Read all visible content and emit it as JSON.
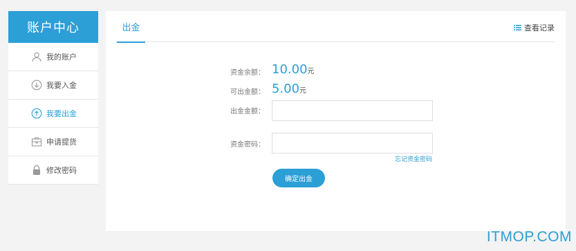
{
  "sidebar": {
    "title": "账户中心",
    "items": [
      {
        "label": "我的账户",
        "icon": "user-icon"
      },
      {
        "label": "我要入金",
        "icon": "arrow-down-circle-icon"
      },
      {
        "label": "我要出金",
        "icon": "arrow-up-circle-icon",
        "active": true
      },
      {
        "label": "申请提货",
        "icon": "briefcase-icon"
      },
      {
        "label": "修改密码",
        "icon": "lock-icon"
      }
    ]
  },
  "main": {
    "tab": "出金",
    "records_label": "查看记录",
    "balance": {
      "label": "资金余额：",
      "value": "10.00",
      "unit": "元"
    },
    "available": {
      "label": "可出金额：",
      "value": "5.00",
      "unit": "元"
    },
    "withdraw_amount": {
      "label": "出金金额：",
      "value": "",
      "placeholder": ""
    },
    "fund_password": {
      "label": "资金密码：",
      "value": "",
      "placeholder": ""
    },
    "forgot_label": "忘记资金密码",
    "confirm_label": "确定出金"
  },
  "watermark": "ITMOP.COM",
  "colors": {
    "accent": "#2b9fd6",
    "background": "#f3f3f3"
  }
}
